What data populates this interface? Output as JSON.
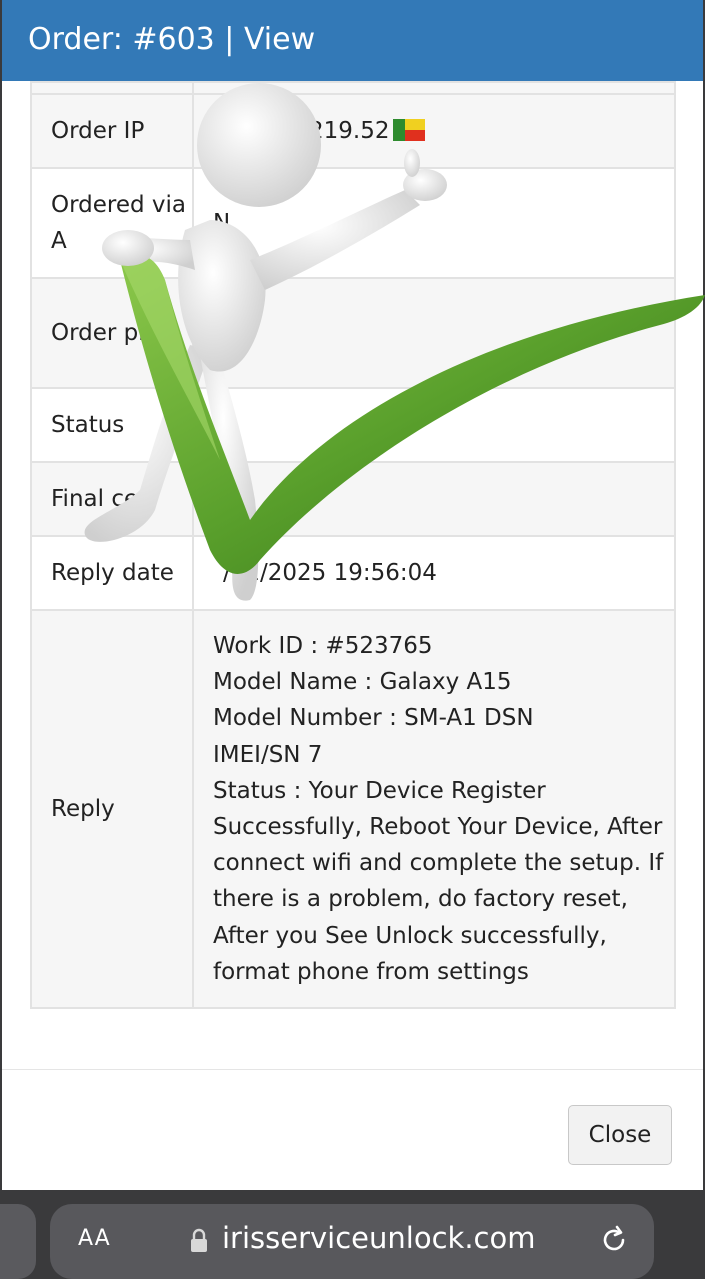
{
  "modal": {
    "title": "Order: #603 | View",
    "header_color": "#3379b7"
  },
  "order_table": {
    "rows": [
      {
        "label": "Order IP",
        "value": "219.52",
        "flag": "benin-flag-icon"
      },
      {
        "label": "Ordered via A",
        "value": "N"
      },
      {
        "label": "Order price",
        "value": ""
      },
      {
        "label": "Status",
        "value": ""
      },
      {
        "label": "Final ce",
        "value": ""
      },
      {
        "label": "Reply date",
        "value": "/02/2025 19:56:04"
      },
      {
        "label": "Reply",
        "value_lines": [
          "Work ID : #523765",
          "Model Name : Galaxy A15",
          "Model Number : SM-A1 DSN",
          "IMEI/SN 7",
          "Status : Your Device Register",
          "Successfully, Reboot Your Device, After",
          "connect wifi and complete the setup. If",
          "there is a problem, do factory reset,",
          "After you See Unlock successfully,",
          "format phone from settings"
        ]
      }
    ]
  },
  "footer": {
    "close_label": "Close"
  },
  "overlay": {
    "icon": "checkmark-mascot-icon",
    "check_color": "#5aa02c"
  },
  "browser": {
    "text_size_label": "AA",
    "url": "irisserviceunlock.com",
    "lock_icon": "lock-icon",
    "reload_icon": "reload-icon"
  }
}
